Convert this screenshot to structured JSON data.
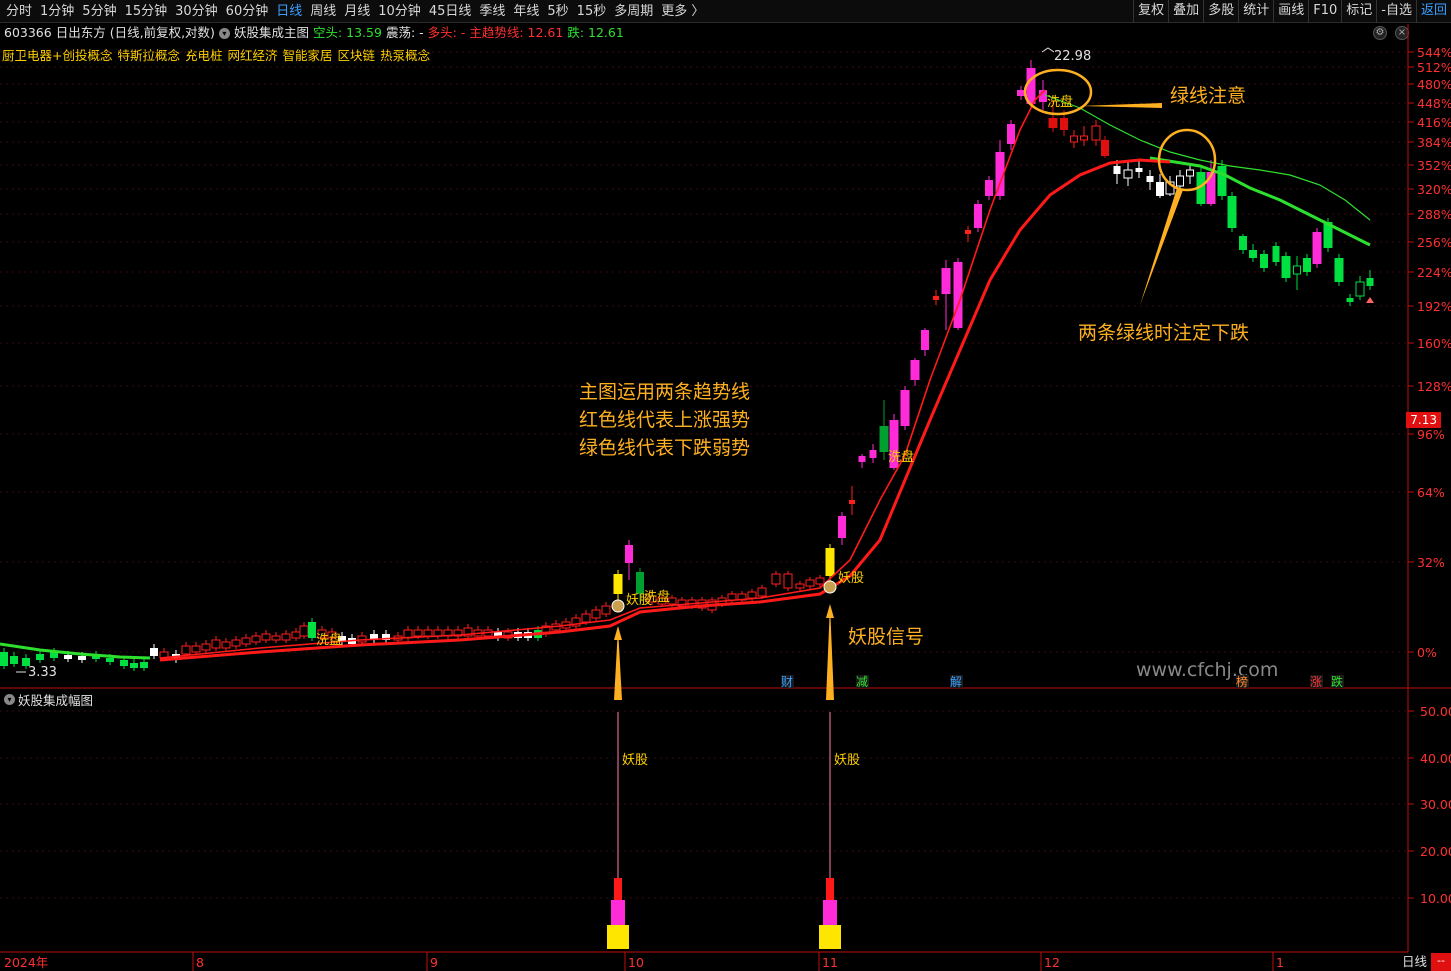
{
  "toolbar": {
    "periods": [
      "分时",
      "1分钟",
      "5分钟",
      "15分钟",
      "30分钟",
      "60分钟",
      "日线",
      "周线",
      "月线",
      "10分钟",
      "45日线",
      "季线",
      "年线",
      "5秒",
      "15秒",
      "多周期"
    ],
    "active_period": "日线",
    "more_label": "更多 〉",
    "tools": [
      "复权",
      "叠加",
      "多股",
      "统计",
      "画线",
      "F10",
      "标记",
      "-自选",
      "返回"
    ]
  },
  "info": {
    "code": "603366",
    "name": "日出东方",
    "mode": "(日线,前复权,对数)",
    "indicator": "妖股集成主图",
    "short_label": "空头: 13.59",
    "shock_label": "震荡: -",
    "long_label": "多头: -",
    "trend_label": "主趋势线: 12.61",
    "fall_label": "跌: 12.61"
  },
  "concepts": [
    "厨卫电器+创投概念",
    "特斯拉概念",
    "充电桩",
    "网红经济",
    "智能家居",
    "区块链",
    "热泵概念"
  ],
  "main_chart": {
    "high_label": "22.98",
    "low_label": "3.33",
    "price_axis": [
      "544%",
      "512%",
      "480%",
      "448%",
      "416%",
      "384%",
      "352%",
      "320%",
      "288%",
      "256%",
      "224%",
      "192%",
      "160%",
      "128%",
      "96%",
      "64%",
      "32%",
      "0%"
    ],
    "current_price": "7.13",
    "signal_marks": [
      "洗盘",
      "妖股",
      "洗盘",
      "洗盘",
      "妖股",
      "洗盘",
      "洗盘"
    ],
    "event_tags": [
      {
        "text": "财",
        "color": "#3aa0ff"
      },
      {
        "text": "减",
        "color": "#2ee02e"
      },
      {
        "text": "解",
        "color": "#3aa0ff"
      },
      {
        "text": "榜",
        "color": "#ff8a30"
      },
      {
        "text": "涨",
        "color": "#ff3030"
      },
      {
        "text": "跌",
        "color": "#2ee02e"
      }
    ],
    "annotations": {
      "note_green": "绿线注意",
      "note_two_green": "两条绿线时注定下跌",
      "note_main_1": "主图运用两条趋势线",
      "note_main_2": "红色线代表上涨强势",
      "note_main_3": "绿色线代表下跌弱势",
      "note_signal": "妖股信号"
    },
    "watermark": "www.cfchj.com"
  },
  "sub_chart": {
    "title": "妖股集成幅图",
    "axis": [
      "50.00",
      "40.00",
      "30.00",
      "20.00",
      "10.00"
    ],
    "bar_label": "妖股"
  },
  "time_axis": [
    "2024年",
    "8",
    "9",
    "10",
    "11",
    "12",
    "1"
  ],
  "status": {
    "dash": "--",
    "period_name": "日线"
  },
  "colors": {
    "bull": "#ff2ad8",
    "bear": "#00e040",
    "trend_red": "#ff1a1a",
    "trend_green": "#2ee02e",
    "annotation": "#ffb020"
  }
}
